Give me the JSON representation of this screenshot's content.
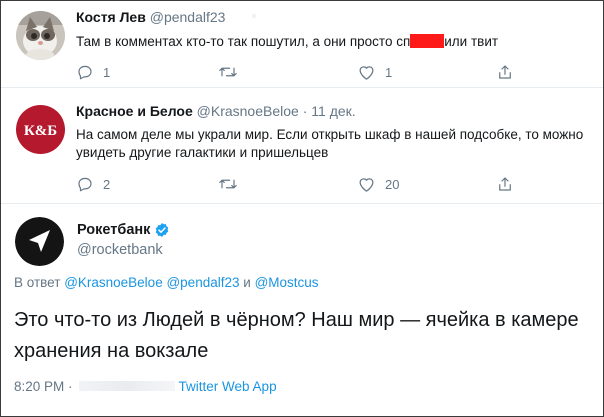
{
  "tweets": [
    {
      "name": "Костя Лев",
      "handle": "@pendalf23",
      "text_before": "Там в комментах кто-то так пошутил, а они просто сп",
      "text_after": "или твит",
      "actions": {
        "reply": "1",
        "retweet": "",
        "like": "1"
      }
    },
    {
      "name": "Красное и Белое",
      "handle": "@KrasnoeBeloe",
      "separator": "·",
      "date": "11 дек.",
      "avatar_text": "К&Б",
      "text": "На самом деле мы украли мир. Если открыть шкаф в нашей подсобке, то можно увидеть другие галактики и пришельцев",
      "actions": {
        "reply": "2",
        "retweet": "",
        "like": "20"
      }
    }
  ],
  "main_tweet": {
    "name": "Рокетбанк",
    "handle": "@rocketbank",
    "reply_prefix": "В ответ",
    "mention1": "@KrasnoeBeloe",
    "mention2": "@pendalf23",
    "conjunction": "и",
    "mention3": "@Mostcus",
    "text": "Это что-то из Людей в чёрном? Наш мир — ячейка в камере хранения на вокзале",
    "time": "8:20 PM ·",
    "source": "Twitter Web App"
  },
  "colors": {
    "accent": "#1b95e0",
    "secondary_text": "#657786",
    "redaction": "#ff1a1a",
    "kb_avatar": "#b5192d",
    "verified": "#1da1f2"
  },
  "icons": [
    "cat-avatar",
    "kb-logo",
    "rocketbank-logo",
    "reply-icon",
    "retweet-icon",
    "like-icon",
    "share-icon",
    "verified-badge-icon"
  ]
}
